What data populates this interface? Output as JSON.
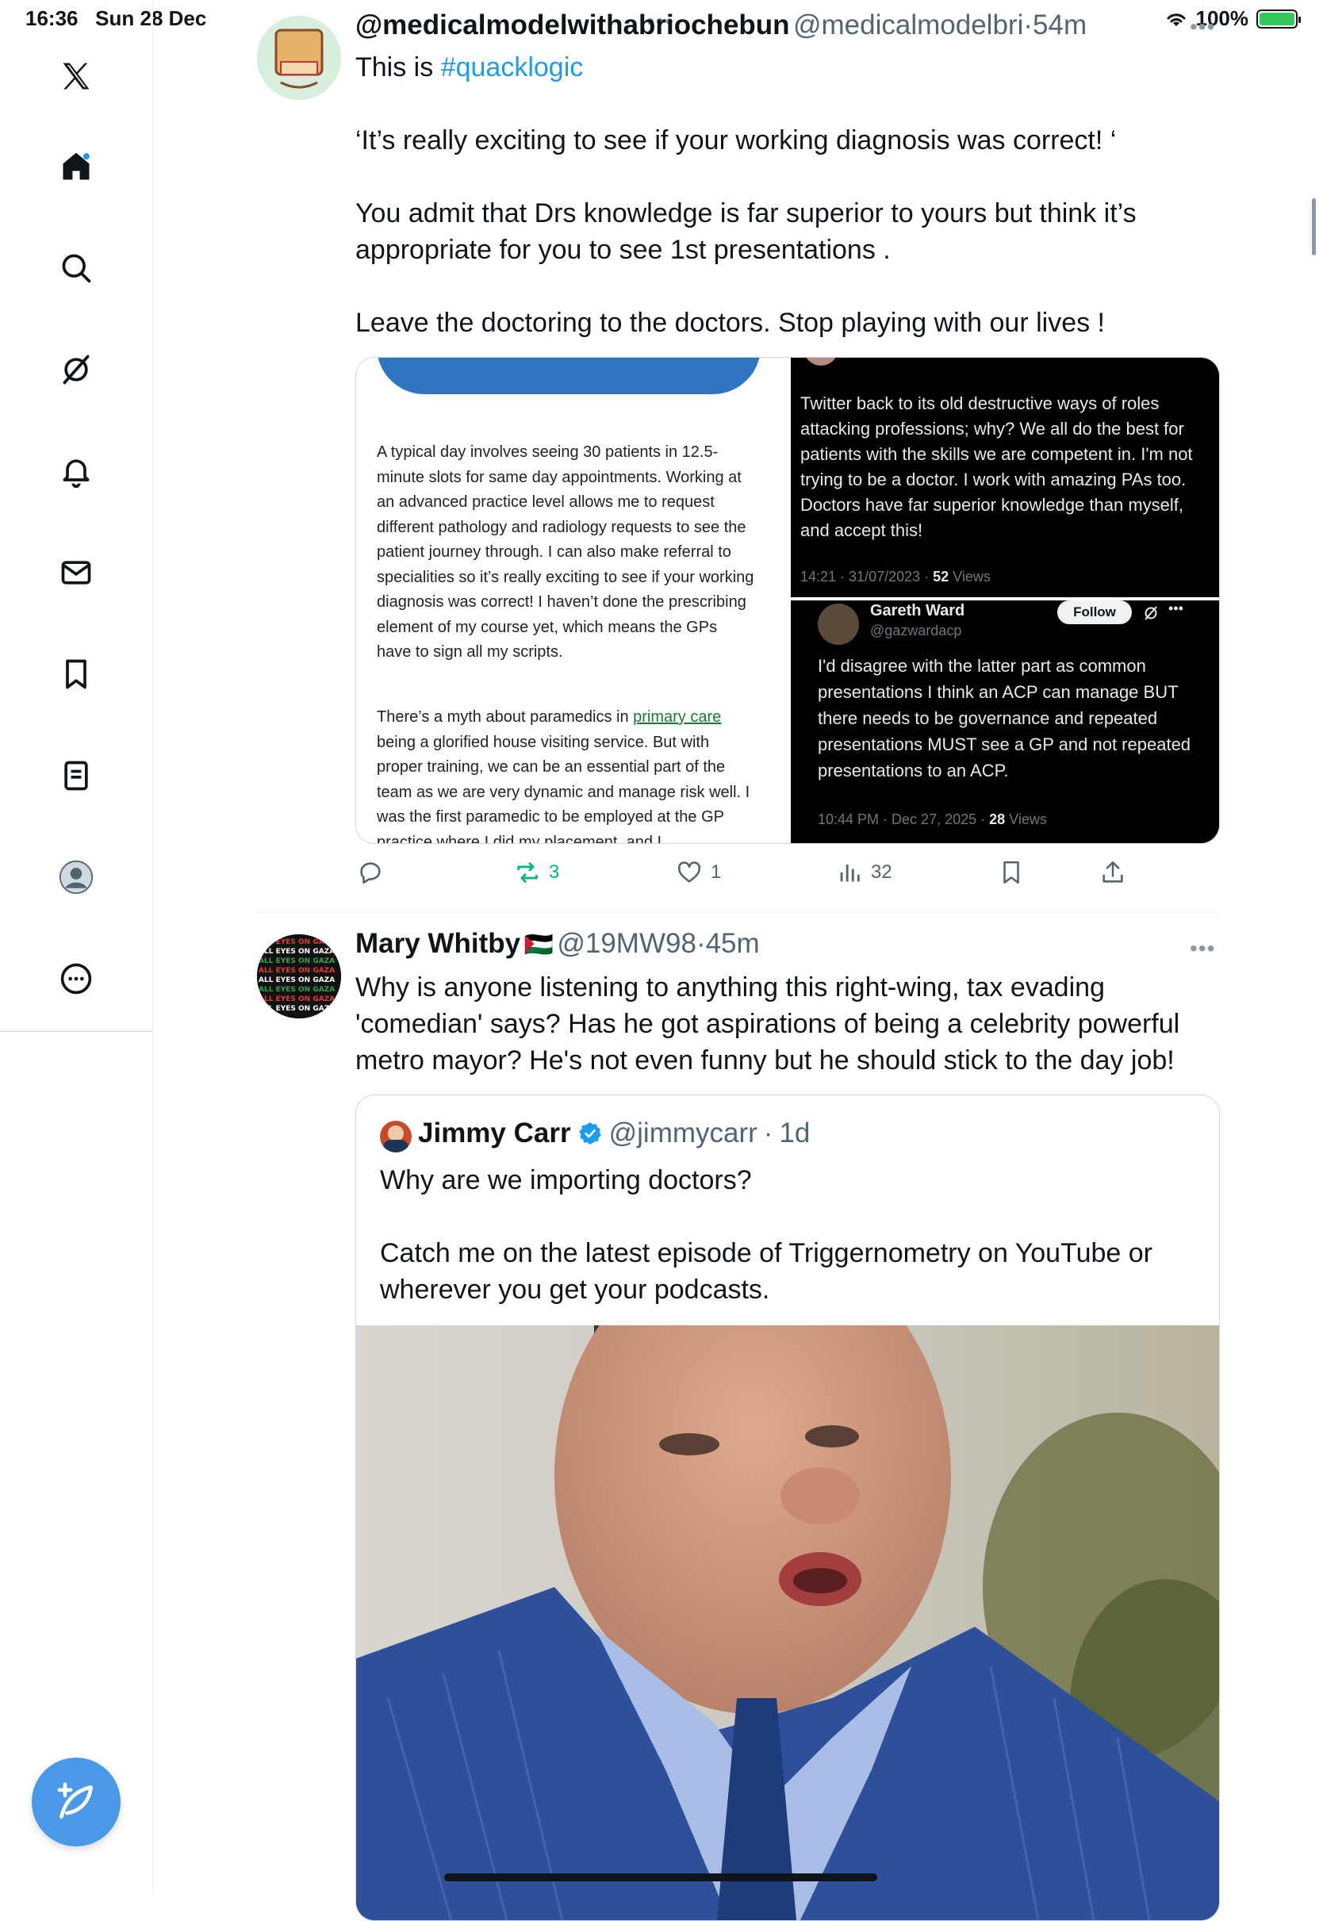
{
  "status_bar": {
    "time": "16:36",
    "date": "Sun 28 Dec",
    "battery": "100%"
  },
  "sidebar": {
    "items": [
      "x-logo",
      "home",
      "explore",
      "grok",
      "notifications",
      "messages",
      "bookmarks",
      "lists",
      "profile",
      "more"
    ],
    "compose_label": "Post"
  },
  "post1": {
    "display_name": "@medicalmodelwithabriochebun",
    "handle": "@medicalmodelbri",
    "time": "54m",
    "text_intro": "This is ",
    "hashtag": "#quacklogic",
    "text_rest": "\n\n‘It’s really exciting to see if your working diagnosis was correct! ‘\n\nYou admit that Drs knowledge is far superior to yours but think it’s appropriate for you to see 1st presentations .\n\nLeave the doctoring to the doctors. Stop playing with our lives !",
    "media_left_p1": "A typical day involves seeing 30 patients in 12.5-minute slots for same day appointments. Working at an advanced practice level allows me to request different pathology and radiology requests to see the patient journey through. I can also make referral to specialities so it’s really exciting to see if your working diagnosis was correct! I haven’t done the prescribing element of my course yet, which means the GPs have to sign all my scripts.",
    "media_left_p2_a": "There’s a myth about paramedics in ",
    "media_left_p2_link": "primary care",
    "media_left_p2_b": " being a glorified house visiting service. But with proper training, we can be an essential part of the team as we are very dynamic and manage risk well. I was the first paramedic to be employed at the GP practice where I did my placement, and I",
    "media_tr_text": "Twitter back to its old destructive ways of roles attacking professions; why?  We all do the best for patients with the skills we are competent in.  I'm not trying to be a doctor.  I work with amazing PAs too.  Doctors have far superior knowledge than myself, and accept this!",
    "media_tr_meta_a": "14:21 · 31/07/2023 · ",
    "media_tr_views": "52",
    "media_tr_views_label": " Views",
    "media_br_name": "Gareth Ward",
    "media_br_handle": "@gazwardacp",
    "media_br_follow": "Follow",
    "media_br_text": "I'd disagree with the latter part as common presentations I think an ACP can manage BUT there needs to be governance and repeated presentations MUST see a GP and not repeated presentations to an ACP.",
    "media_br_meta_a": "10:44 PM · Dec 27, 2025 · ",
    "media_br_views": "28",
    "media_br_views_label": " Views",
    "stats": {
      "retweets": "3",
      "likes": "1",
      "views": "32"
    }
  },
  "post2": {
    "display_name": "Mary Whitby",
    "flag": "🇵🇸",
    "handle": "@19MW98",
    "time": "45m",
    "text": "Why is anyone listening to anything this right-wing, tax evading 'comedian' says? Has he got aspirations of being a celebrity powerful metro mayor? He's not even funny but he should stick to the day job!",
    "quote": {
      "display_name": "Jimmy Carr",
      "handle": "@jimmycarr",
      "time": "1d",
      "text": "Why are we importing doctors?\n\nCatch me on the latest episode of Triggernometry on YouTube or wherever you get your podcasts."
    }
  },
  "colors": {
    "accent": "#1d9bf0",
    "retweet_green": "#00ba7c",
    "fab": "#4a99e9"
  }
}
